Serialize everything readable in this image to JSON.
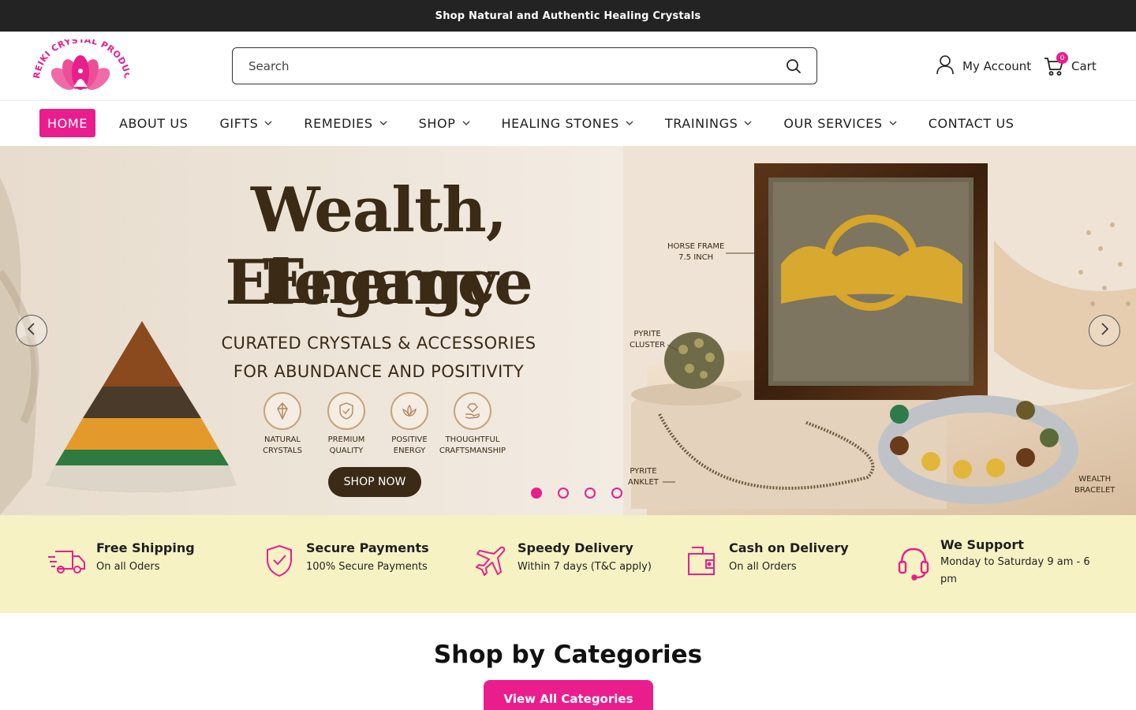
{
  "announcement": "Shop Natural and Authentic Healing Crystals",
  "brand": {
    "logo_text": "REIKI CRYSTAL PRODUCTS",
    "accent": "#e91e8c"
  },
  "search": {
    "placeholder": "Search"
  },
  "account": {
    "label": "My Account"
  },
  "cart": {
    "label": "Cart",
    "count": "0"
  },
  "nav": {
    "home": "HOME",
    "about": "ABOUT US",
    "gifts": "GIFTS",
    "remedies": "REMEDIES",
    "shop": "SHOP",
    "healing": "HEALING STONES",
    "trainings": "TRAININGS",
    "services": "OUR SERVICES",
    "contact": "CONTACT US"
  },
  "hero": {
    "title_line1": "Wealth, Energy",
    "title_line2": "Elegance",
    "sub_line1": "CURATED CRYSTALS & ACCESSORIES",
    "sub_line2": "FOR ABUNDANCE AND POSITIVITY",
    "badges": [
      {
        "line1": "NATURAL",
        "line2": "CRYSTALS"
      },
      {
        "line1": "PREMIUM",
        "line2": "QUALITY"
      },
      {
        "line1": "POSITIVE",
        "line2": "ENERGY"
      },
      {
        "line1": "THOUGHTFUL",
        "line2": "CRAFTSMANSHIP"
      }
    ],
    "cta": "SHOP NOW",
    "callouts": {
      "horse_1": "HORSE FRAME",
      "horse_2": "7.5 INCH",
      "pyrite_1": "PYRITE",
      "pyrite_2": "CLUSTER",
      "anklet_1": "PYRITE",
      "anklet_2": "ANKLET",
      "bracelet_1": "WEALTH",
      "bracelet_2": "BRACELET"
    },
    "slides_total": 4,
    "active_slide": 1
  },
  "features": [
    {
      "title": "Free Shipping",
      "sub": "On all Oders",
      "icon": "truck-icon"
    },
    {
      "title": "Secure Payments",
      "sub": "100% Secure Payments",
      "icon": "shield-check-icon"
    },
    {
      "title": "Speedy Delivery",
      "sub": "Within 7 days (T&C apply)",
      "icon": "airplane-icon"
    },
    {
      "title": "Cash on Delivery",
      "sub": "On all Orders",
      "icon": "wallet-icon"
    },
    {
      "title": "We Support",
      "sub": "Monday to Saturday 9 am - 6 pm",
      "icon": "headset-icon"
    }
  ],
  "categories": {
    "title": "Shop by Categories",
    "button": "View All Categories"
  }
}
